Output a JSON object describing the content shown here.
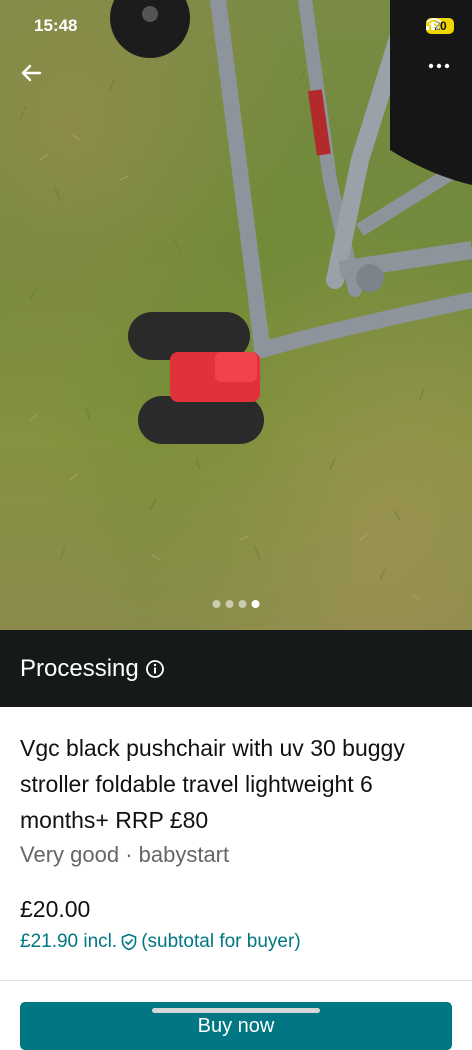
{
  "status_bar": {
    "time": "15:48",
    "battery": "20"
  },
  "photo": {
    "page_count": 4,
    "active_index": 3
  },
  "banner": {
    "label": "Processing"
  },
  "item": {
    "title": "Vgc black pushchair with uv 30 buggy stroller foldable travel lightweight 6 months+ RRP £80",
    "condition_brand": "Very good · babystart",
    "price": "£20.00",
    "buyer_price": "£21.90 incl.",
    "buyer_note": "(subtotal for buyer)"
  },
  "action": {
    "buy_label": "Buy now"
  },
  "colors": {
    "accent": "#007782",
    "banner_bg": "#15191a"
  }
}
